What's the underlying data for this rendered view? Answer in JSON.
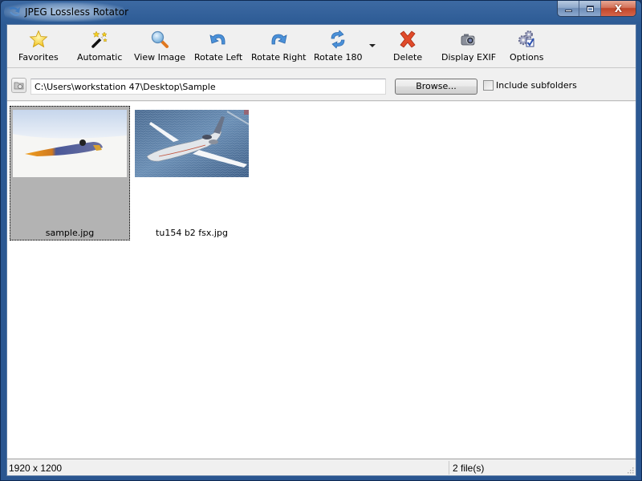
{
  "window": {
    "title": "JPEG Lossless Rotator",
    "controls": {
      "minimize": "minimize",
      "maximize": "maximize",
      "close": "X"
    }
  },
  "toolbar": {
    "buttons": [
      {
        "id": "favorites",
        "label": "Favorites",
        "icon": "star-icon"
      },
      {
        "id": "automatic",
        "label": "Automatic",
        "icon": "magic-wand-icon"
      },
      {
        "id": "view-image",
        "label": "View Image",
        "icon": "magnifier-icon"
      },
      {
        "id": "rotate-left",
        "label": "Rotate Left",
        "icon": "rotate-left-icon"
      },
      {
        "id": "rotate-right",
        "label": "Rotate Right",
        "icon": "rotate-right-icon"
      },
      {
        "id": "rotate-180",
        "label": "Rotate 180",
        "icon": "rotate-180-icon"
      },
      {
        "id": "delete",
        "label": "Delete",
        "icon": "delete-x-icon"
      },
      {
        "id": "display-exif",
        "label": "Display EXIF",
        "icon": "camera-icon"
      },
      {
        "id": "options",
        "label": "Options",
        "icon": "gears-check-icon"
      }
    ]
  },
  "pathbar": {
    "path": "C:\\Users\\workstation 47\\Desktop\\Sample",
    "browse_label": "Browse...",
    "include_subfolders_label": "Include subfolders",
    "include_subfolders_checked": false
  },
  "files": [
    {
      "name": "sample.jpg",
      "selected": true
    },
    {
      "name": "tu154 b2 fsx.jpg",
      "selected": false
    }
  ],
  "status": {
    "dimensions": "1920 x 1200",
    "file_count": "2 file(s)"
  },
  "colors": {
    "selection_bg": "#b3b3b3",
    "window_frame": "#2c5a94"
  }
}
